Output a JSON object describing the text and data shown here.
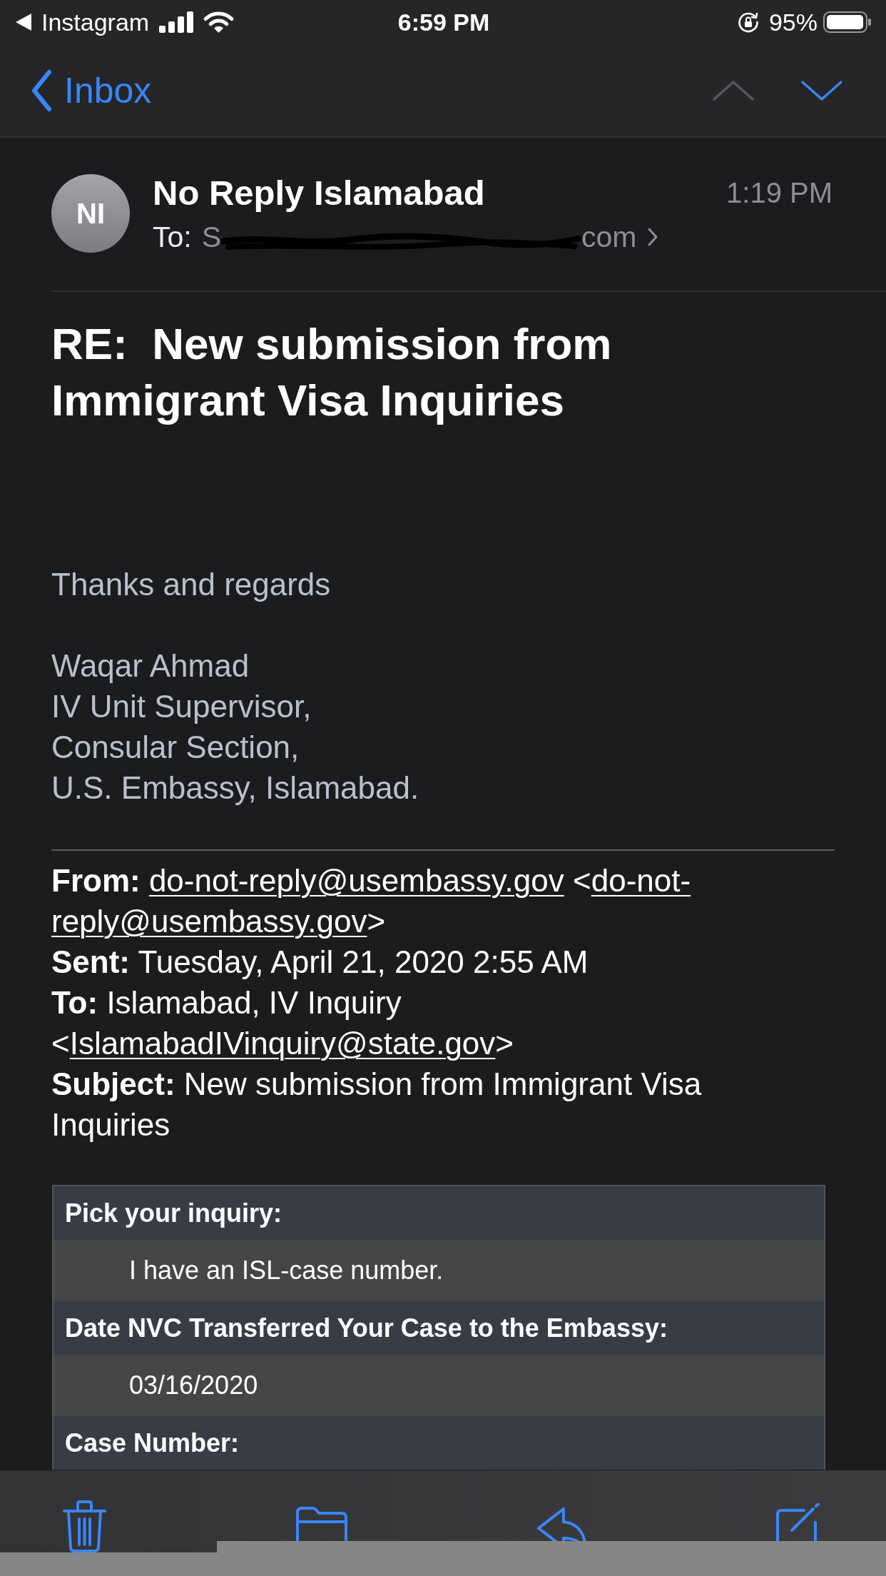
{
  "status_bar": {
    "back_app": "Instagram",
    "time": "6:59 PM",
    "battery": "95%"
  },
  "nav": {
    "back_label": "Inbox",
    "arrows": [
      {
        "kind": "up",
        "disabled": true
      },
      {
        "kind": "down",
        "disabled": false
      }
    ]
  },
  "message": {
    "avatar_initials": "NI",
    "sender": "No Reply Islamabad",
    "time": "1:19 PM",
    "to_label": "To:",
    "recipient": {
      "start": "S",
      "end": "com",
      "redacted": true
    },
    "subject": "RE:  New submission from Immigrant Visa Inquiries"
  },
  "body": {
    "signoff": "Thanks and regards",
    "signature": [
      "Waqar Ahmad",
      "IV Unit Supervisor,",
      "Consular Section,",
      "U.S. Embassy, Islamabad."
    ],
    "header_fields": [
      {
        "label": "From:",
        "parts": [
          {
            "kind": "link",
            "text": "do-not-reply@usembassy.gov"
          },
          {
            "kind": "text",
            "text": " <"
          },
          {
            "kind": "link",
            "text": "do-not-"
          },
          {
            "kind": "link",
            "text": "reply@usembassy.gov"
          },
          {
            "kind": "text",
            "text": ">"
          }
        ]
      },
      {
        "label": "Sent:",
        "parts": [
          {
            "kind": "text",
            "text": "Tuesday, April 21, 2020 2:55 AM"
          }
        ]
      },
      {
        "label": "To:",
        "parts": [
          {
            "kind": "text",
            "text": "Islamabad, IV Inquiry <"
          },
          {
            "kind": "link",
            "text": "IslamabadIVinquiry@state.gov"
          },
          {
            "kind": "text",
            "text": ">"
          }
        ]
      },
      {
        "label": "Subject:",
        "parts": [
          {
            "kind": "text",
            "text": "New submission from Immigrant Visa Inquiries"
          }
        ]
      }
    ],
    "form_table": {
      "rows": [
        {
          "kind": "label",
          "text": "Pick your inquiry:"
        },
        {
          "kind": "answer",
          "text": "I have an ISL-case number."
        },
        {
          "kind": "label",
          "text": "Date NVC Transferred Your Case to the Embassy:"
        },
        {
          "kind": "answer",
          "text": "03/16/2020"
        },
        {
          "kind": "label",
          "text": "Case Number:"
        }
      ]
    }
  }
}
